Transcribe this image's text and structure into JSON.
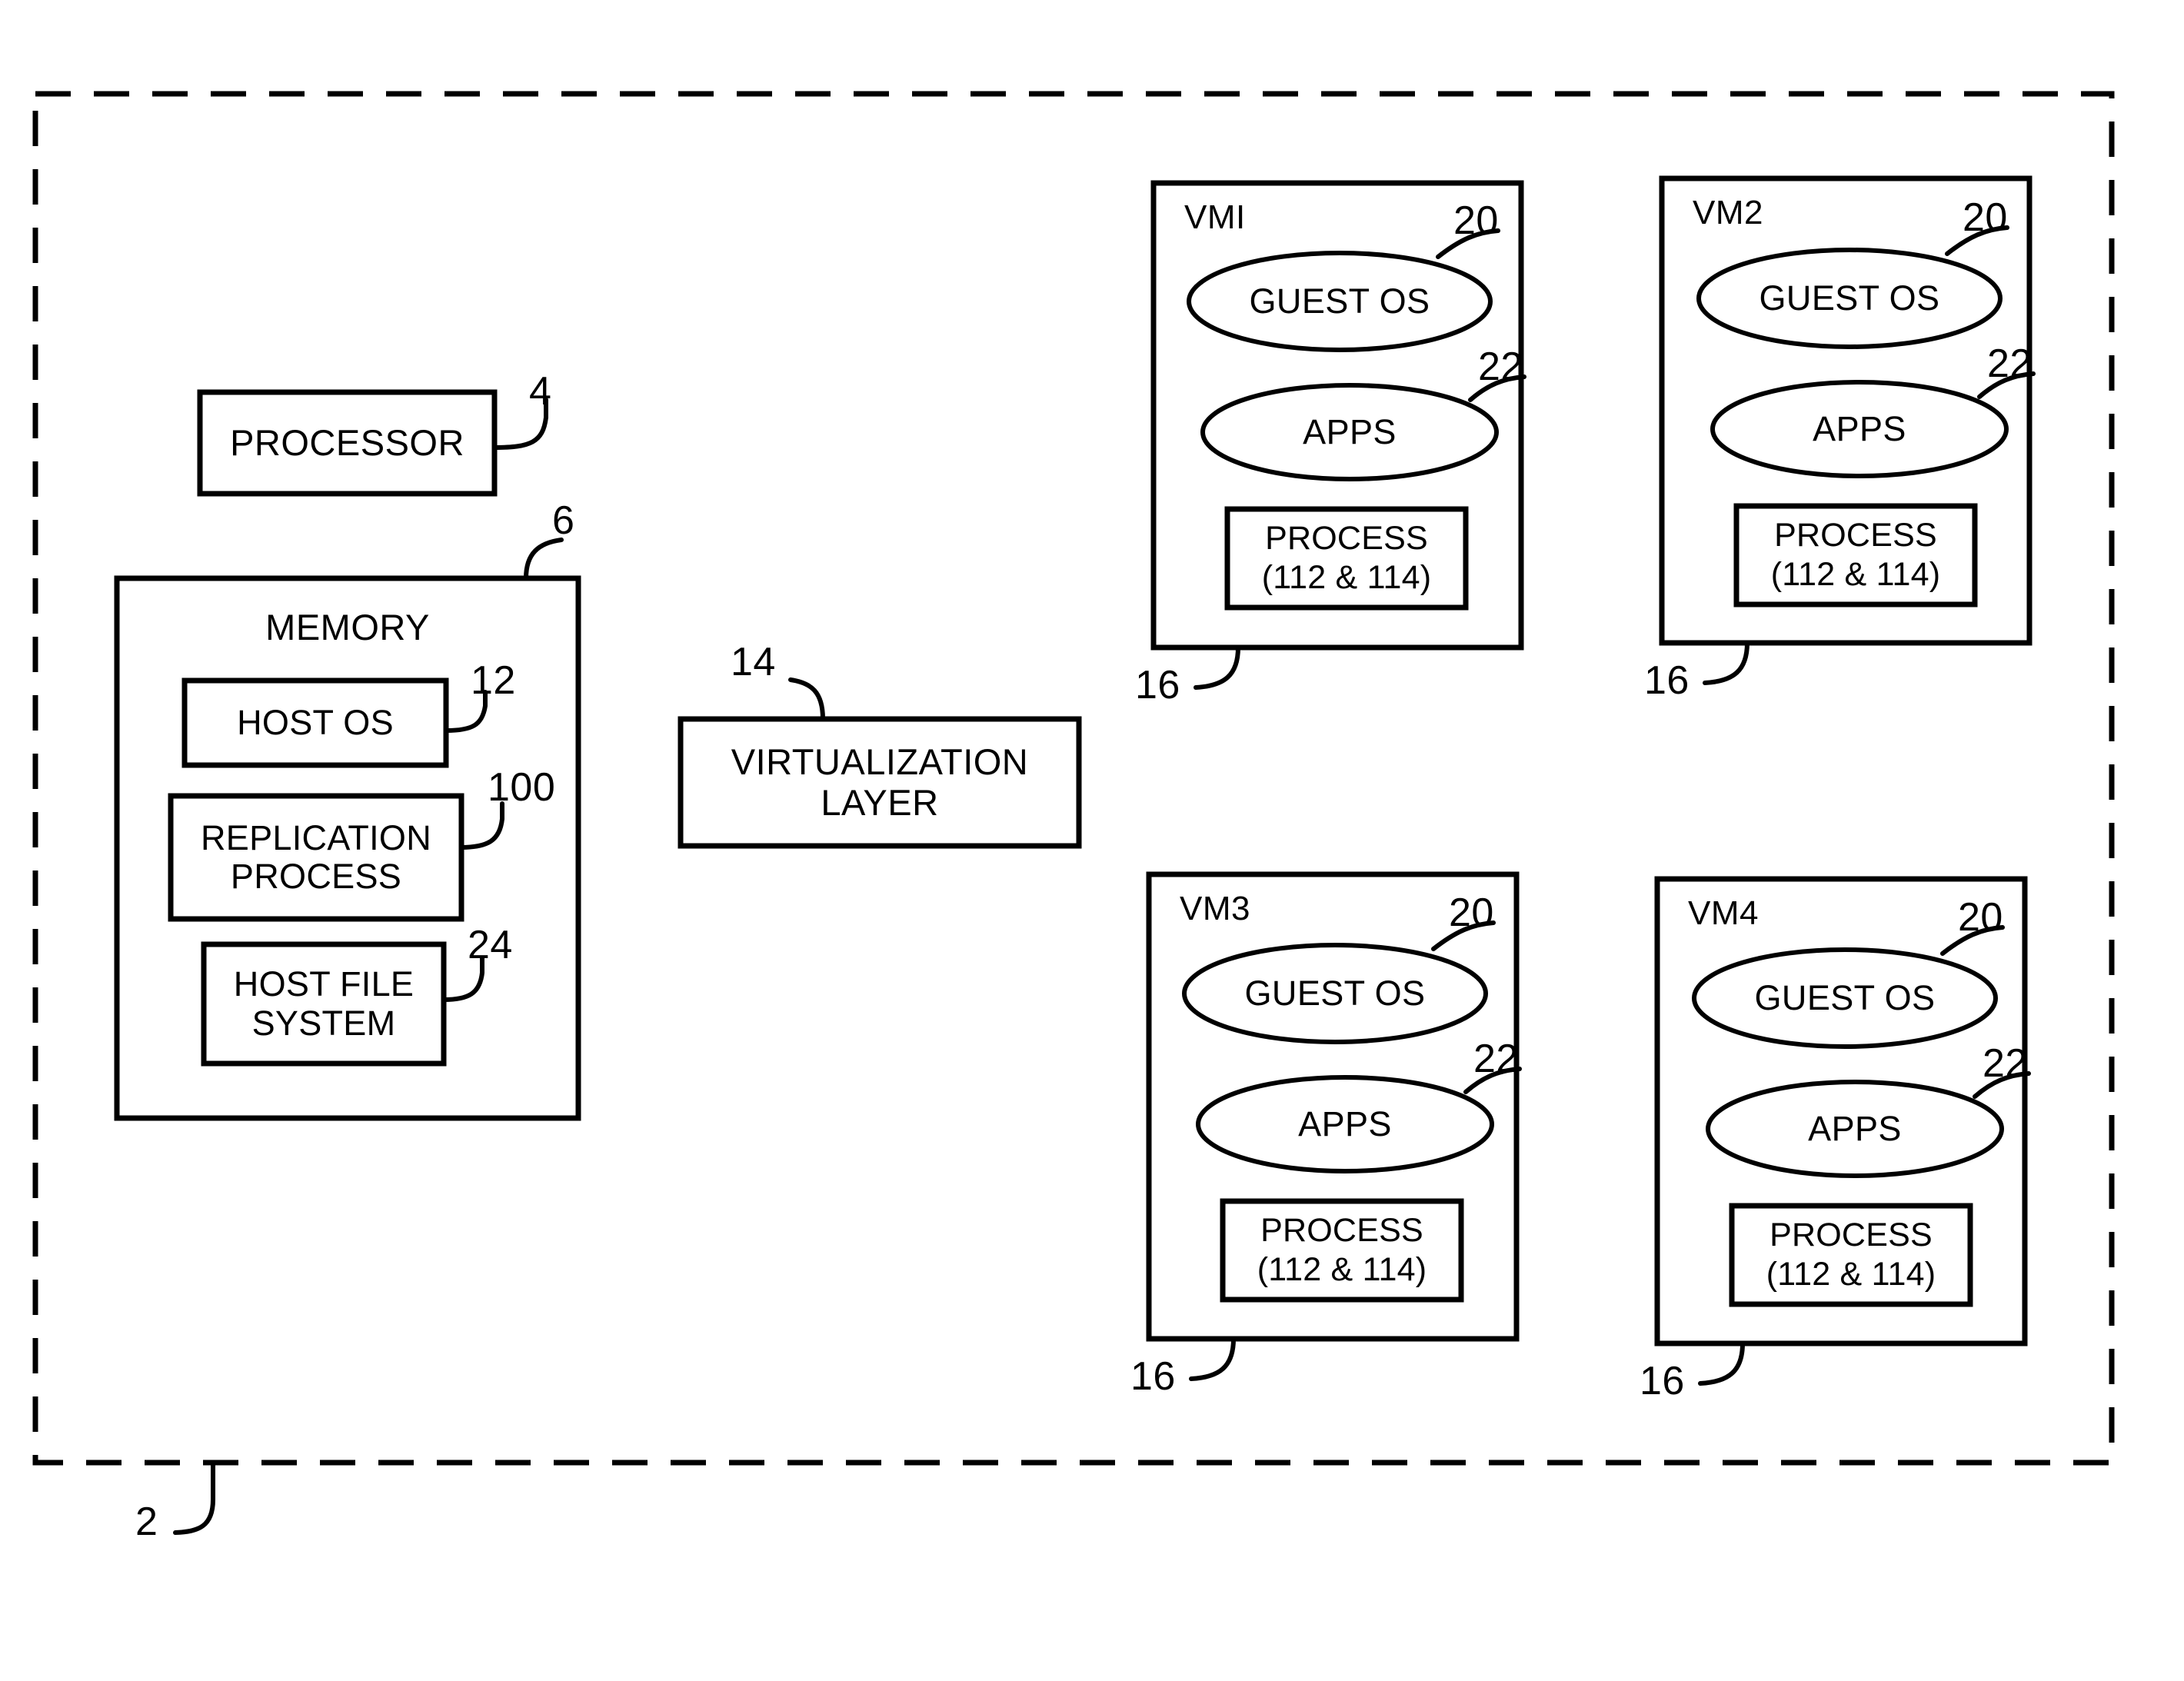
{
  "figure": {
    "type": "patent-block-diagram",
    "system_reference": "2",
    "host": {
      "processor": {
        "label": "PROCESSOR",
        "ref": "4"
      },
      "memory": {
        "label": "MEMORY",
        "ref": "6",
        "items": [
          {
            "label": "HOST OS",
            "ref": "12"
          },
          {
            "label": "REPLICATION\nPROCESS",
            "ref": "100"
          },
          {
            "label": "HOST FILE\nSYSTEM",
            "ref": "24"
          }
        ]
      },
      "virtualization_layer": {
        "label": "VIRTUALIZATION\nLAYER",
        "ref": "14"
      }
    },
    "virtual_machines": [
      {
        "name": "VMI",
        "vm_ref": "16",
        "guest_os": {
          "label": "GUEST OS",
          "ref": "20"
        },
        "apps": {
          "label": "APPS",
          "ref": "22"
        },
        "process": {
          "line1": "PROCESS",
          "line2": "(112 & 114)"
        }
      },
      {
        "name": "VM2",
        "vm_ref": "16",
        "guest_os": {
          "label": "GUEST OS",
          "ref": "20"
        },
        "apps": {
          "label": "APPS",
          "ref": "22"
        },
        "process": {
          "line1": "PROCESS",
          "line2": "(112 & 114)"
        }
      },
      {
        "name": "VM3",
        "vm_ref": "16",
        "guest_os": {
          "label": "GUEST OS",
          "ref": "20"
        },
        "apps": {
          "label": "APPS",
          "ref": "22"
        },
        "process": {
          "line1": "PROCESS",
          "line2": "(112 & 114)"
        }
      },
      {
        "name": "VM4",
        "vm_ref": "16",
        "guest_os": {
          "label": "GUEST OS",
          "ref": "20"
        },
        "apps": {
          "label": "APPS",
          "ref": "22"
        },
        "process": {
          "line1": "PROCESS",
          "line2": "(112 & 114)"
        }
      }
    ],
    "colors": {
      "ink": "#000000",
      "paper": "#ffffff"
    }
  }
}
